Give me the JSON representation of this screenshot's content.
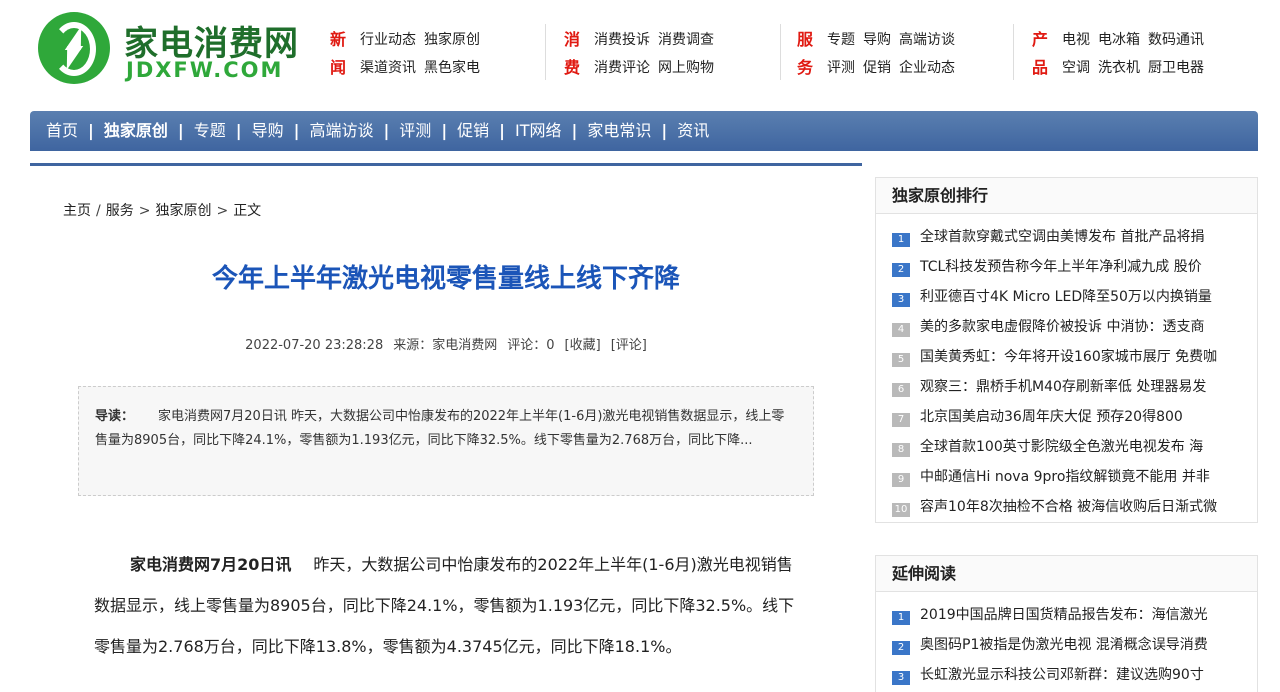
{
  "logo": {
    "cn": "家电消费网",
    "en": "JDXFW.COM"
  },
  "nav_groups": [
    {
      "cat1": "新",
      "cat2": "闻",
      "row1": [
        "行业动态",
        "独家原创"
      ],
      "row2": [
        "渠道资讯",
        "黑色家电"
      ]
    },
    {
      "cat1": "消",
      "cat2": "费",
      "row1": [
        "消费投诉",
        "消费调查"
      ],
      "row2": [
        "消费评论",
        "网上购物"
      ]
    },
    {
      "cat1": "服",
      "cat2": "务",
      "row1": [
        "专题",
        "导购",
        "高端访谈"
      ],
      "row2": [
        "评测",
        "促销",
        "企业动态"
      ]
    },
    {
      "cat1": "产",
      "cat2": "品",
      "row1": [
        "电视",
        "电冰箱",
        "数码通讯"
      ],
      "row2": [
        "空调",
        "洗衣机",
        "厨卫电器"
      ]
    }
  ],
  "main_nav": [
    "首页",
    "独家原创",
    "专题",
    "导购",
    "高端访谈",
    "评测",
    "促销",
    "IT网络",
    "家电常识",
    "资讯"
  ],
  "breadcrumb": {
    "home": "主页",
    "sep1": "/",
    "section": "服务",
    "sep2": ">",
    "sub": "独家原创",
    "sep3": ">",
    "current": "正文"
  },
  "article": {
    "title": "今年上半年激光电视零售量线上线下齐降",
    "date": "2022-07-20 23:28:28",
    "source": "来源：家电消费网",
    "comments": "评论：0",
    "fav": "[收藏]",
    "comment_link": "[评论]",
    "lead_label": "导读：",
    "lead_text": "家电消费网7月20日讯 昨天，大数据公司中怡康发布的2022年上半年(1-6月)激光电视销售数据显示，线上零售量为8905台，同比下降24.1%，零售额为1.193亿元，同比下降32.5%。线下零售量为2.768万台，同比下降...",
    "body_lead": "家电消费网7月20日讯",
    "body_text": "昨天，大数据公司中怡康发布的2022年上半年(1-6月)激光电视销售数据显示，线上零售量为8905台，同比下降24.1%，零售额为1.193亿元，同比下降32.5%。线下零售量为2.768万台，同比下降13.8%，零售额为4.3745亿元，同比下降18.1%。"
  },
  "rank": {
    "title": "独家原创排行",
    "items": [
      {
        "n": "1",
        "t": "全球首款穿戴式空调由美博发布 首批产品将捐"
      },
      {
        "n": "2",
        "t": "TCL科技发预告称今年上半年净利减九成 股价"
      },
      {
        "n": "3",
        "t": "利亚德百寸4K Micro LED降至50万以内换销量"
      },
      {
        "n": "4",
        "t": "美的多款家电虚假降价被投诉 中消协：透支商"
      },
      {
        "n": "5",
        "t": "国美黄秀虹：今年将开设160家城市展厅 免费咖"
      },
      {
        "n": "6",
        "t": "观察三：鼎桥手机M40存刷新率低 处理器易发"
      },
      {
        "n": "7",
        "t": "北京国美启动36周年庆大促 预存20得800"
      },
      {
        "n": "8",
        "t": "全球首款100英寸影院级全色激光电视发布 海"
      },
      {
        "n": "9",
        "t": "中邮通信Hi nova 9pro指纹解锁竟不能用 并非"
      },
      {
        "n": "10",
        "t": "容声10年8次抽检不合格 被海信收购后日渐式微"
      }
    ]
  },
  "related": {
    "title": "延伸阅读",
    "items": [
      {
        "n": "1",
        "t": "2019中国品牌日国货精品报告发布：海信激光"
      },
      {
        "n": "2",
        "t": "奥图码P1被指是伪激光电视 混淆概念误导消费"
      },
      {
        "n": "3",
        "t": "长虹激光显示科技公司邓新群：建议选购90寸"
      }
    ]
  }
}
